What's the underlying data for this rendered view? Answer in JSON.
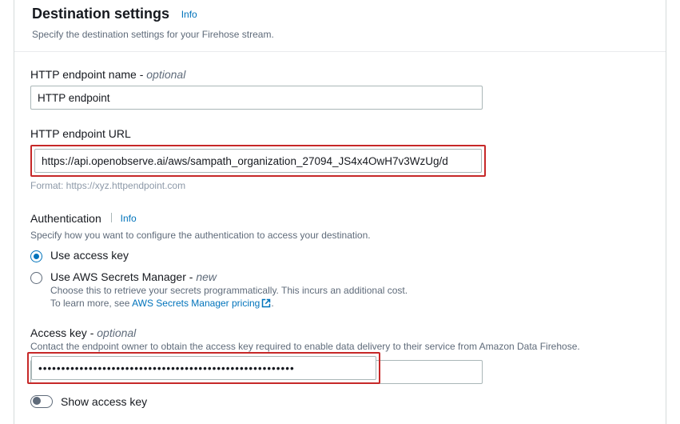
{
  "section": {
    "title": "Destination settings",
    "info_label": "Info",
    "description": "Specify the destination settings for your Firehose stream."
  },
  "endpoint_name": {
    "label": "HTTP endpoint name - ",
    "optional": "optional",
    "value": "HTTP endpoint"
  },
  "endpoint_url": {
    "label": "HTTP endpoint URL",
    "value": "https://api.openobserve.ai/aws/sampath_organization_27094_JS4x4OwH7v3WzUg/d",
    "helper": "Format: https://xyz.httpendpoint.com"
  },
  "auth": {
    "title": "Authentication",
    "info_label": "Info",
    "description": "Specify how you want to configure the authentication to access your destination.",
    "option_access_key": "Use access key",
    "option_secrets_prefix": "Use AWS Secrets Manager - ",
    "option_secrets_new": "new",
    "option_secrets_desc_1": "Choose this to retrieve your secrets programmatically. This incurs an additional cost.",
    "option_secrets_desc_2": "To learn more, see ",
    "pricing_link": "AWS Secrets Manager pricing"
  },
  "access_key": {
    "label": "Access key - ",
    "optional": "optional",
    "description": "Contact the endpoint owner to obtain the access key required to enable data delivery to their service from Amazon Data Firehose.",
    "masked_value": "••••••••••••••••••••••••••••••••••••••••••••••••••••••••",
    "toggle_label": "Show access key"
  }
}
